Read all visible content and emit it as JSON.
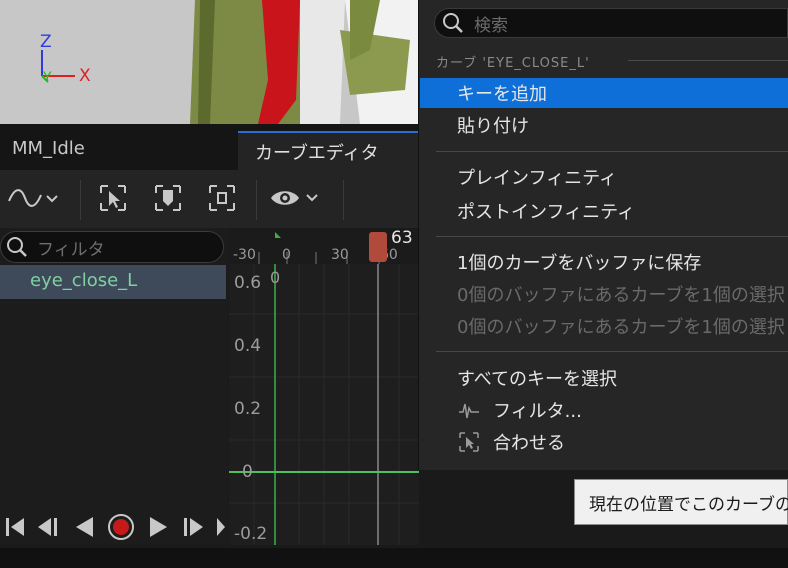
{
  "viewport": {
    "axis_z": "Z",
    "axis_y": "Y",
    "axis_x": "X"
  },
  "tabs": {
    "idle": "MM_Idle",
    "curve_editor": "カーブエディタ"
  },
  "filter": {
    "placeholder": "フィルタ"
  },
  "curves": {
    "items": [
      {
        "label": "eye_close_L",
        "color": "#7fd1a0"
      }
    ]
  },
  "timeline": {
    "ticks": [
      "-30",
      "0",
      "30",
      "60"
    ],
    "playhead_label": "63",
    "key_label": "0"
  },
  "graph": {
    "y_labels": [
      "0.6",
      "0.4",
      "0.2",
      "0",
      "-0.2"
    ]
  },
  "menu": {
    "search_placeholder": "検索",
    "section_title": "カーブ 'EYE_CLOSE_L'",
    "items": [
      {
        "label": "キーを追加",
        "highlighted": true
      },
      {
        "label": "貼り付け"
      },
      {
        "label": "プレインフィニティ"
      },
      {
        "label": "ポストインフィニティ"
      },
      {
        "label": "1個のカーブをバッファに保存"
      },
      {
        "label": "0個のバッファにあるカーブを1個の選択",
        "disabled": true
      },
      {
        "label": "0個のバッファにあるカーブを1個の選択",
        "disabled": true
      },
      {
        "label": "すべてのキーを選択"
      },
      {
        "label": "フィルタ..."
      },
      {
        "label": "合わせる"
      }
    ]
  },
  "tooltip": {
    "text": "現在の位置でこのカーブの"
  },
  "colors": {
    "accent": "#0e6fd9",
    "curve_green": "#4cc05a",
    "playhead": "#b04a3a"
  }
}
